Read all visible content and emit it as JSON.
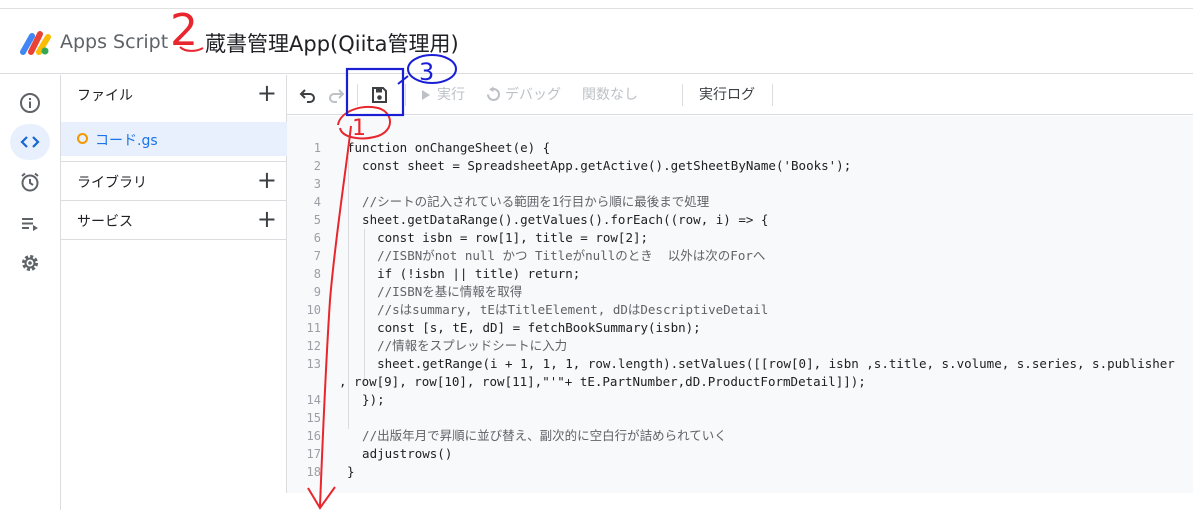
{
  "header": {
    "brand": "Apps Script",
    "project_title": "蔵書管理App(Qiita管理用)"
  },
  "rail": {
    "icons": [
      "info-icon",
      "code-icon",
      "alarm-icon",
      "executions-icon",
      "settings-icon"
    ],
    "active": "code-icon"
  },
  "files_panel": {
    "files_label": "ファイル",
    "file_name": "コード.gs",
    "libraries_label": "ライブラリ",
    "services_label": "サービス"
  },
  "toolbar": {
    "run_label": "実行",
    "debug_label": "デバッグ",
    "function_label": "関数なし",
    "log_label": "実行ログ"
  },
  "code_lines": [
    {
      "n": "1",
      "t": "function onChangeSheet(e) {"
    },
    {
      "n": "2",
      "t": "  const sheet = SpreadsheetApp.getActive().getSheetByName('Books');"
    },
    {
      "n": "3",
      "t": ""
    },
    {
      "n": "4",
      "t": "  //シートの記入されている範囲を1行目から順に最後まで処理"
    },
    {
      "n": "5",
      "t": "  sheet.getDataRange().getValues().forEach((row, i) => {"
    },
    {
      "n": "6",
      "t": "    const isbn = row[1], title = row[2];"
    },
    {
      "n": "7",
      "t": "    //ISBNがnot null かつ Titleがnullのとき  以外は次のForへ"
    },
    {
      "n": "8",
      "t": "    if (!isbn || title) return;"
    },
    {
      "n": "9",
      "t": "    //ISBNを基に情報を取得"
    },
    {
      "n": "10",
      "t": "    //sはsummary, tEはTitleElement, dDはDescriptiveDetail"
    },
    {
      "n": "11",
      "t": "    const [s, tE, dD] = fetchBookSummary(isbn);"
    },
    {
      "n": "12",
      "t": "    //情報をスプレッドシートに入力"
    },
    {
      "n": "13",
      "t": "    sheet.getRange(i + 1, 1, 1, row.length).setValues([[row[0], isbn ,s.title, s.volume, s.series, s.publisher"
    },
    {
      "n": "",
      "t": ", row[9], row[10], row[11],\"'\"+ tE.PartNumber,dD.ProductFormDetail]]);"
    },
    {
      "n": "14",
      "t": "  });"
    },
    {
      "n": "15",
      "t": ""
    },
    {
      "n": "16",
      "t": "  //出版年月で昇順に並び替え、副次的に空白行が詰められていく"
    },
    {
      "n": "17",
      "t": "  adjustrows()"
    },
    {
      "n": "18",
      "t": "}"
    }
  ],
  "annotations": {
    "mark_1": "1",
    "mark_2": "2",
    "mark_3": "3",
    "red": "#e8262d",
    "blue": "#1a1fd6"
  }
}
